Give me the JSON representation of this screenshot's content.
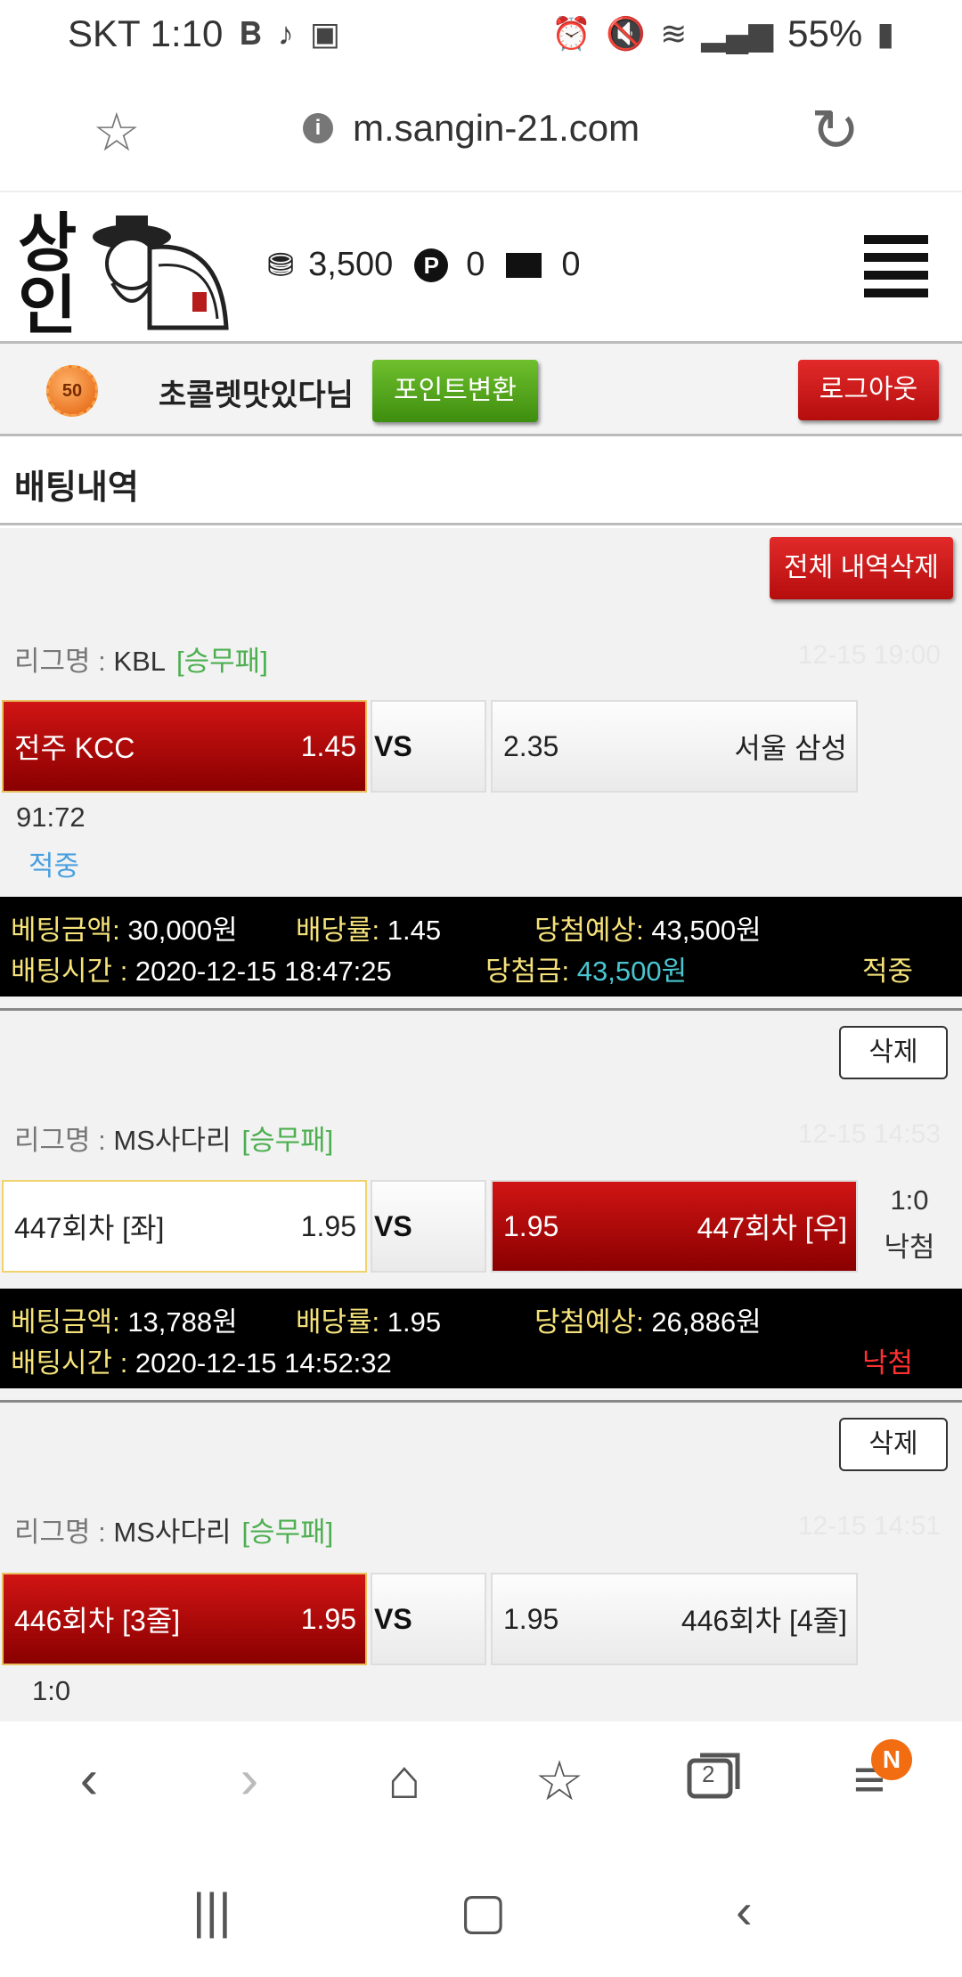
{
  "status": {
    "carrier_time": "SKT 1:10",
    "battery": "55%"
  },
  "browser": {
    "url": "m.sangin-21.com"
  },
  "header": {
    "logo_text": "상인",
    "coins": "3,500",
    "points": "0",
    "messages": "0"
  },
  "userbar": {
    "level": "50",
    "nickname": "초콜렛맛있다님",
    "convert_button": "포인트변환",
    "logout_button": "로그아웃"
  },
  "page": {
    "title": "배팅내역",
    "delete_all_button": "전체 내역삭제"
  },
  "labels": {
    "league_prefix": "리그명 : ",
    "vs": "VS",
    "bet_amount": "베팅금액: ",
    "odds": "배당률: ",
    "expected": "당첨예상: ",
    "bet_time": "배팅시간 : ",
    "win_amount": "당첨금: ",
    "delete": "삭제"
  },
  "bets": [
    {
      "league": "KBL",
      "type": "[승무패]",
      "date": "12-15 19:00",
      "home": "전주 KCC",
      "home_odds": "1.45",
      "away_odds": "2.35",
      "away": "서울 삼성",
      "score": "91:72",
      "game_result": "적중",
      "amount": "30,000원",
      "rate": "1.45",
      "expected": "43,500원",
      "time": "2020-12-15 18:47:25",
      "winnings": "43,500원",
      "status": "적중"
    },
    {
      "league": "MS사다리",
      "type": "[승무패]",
      "date": "12-15 14:53",
      "home": "447회차 [좌]",
      "home_odds": "1.95",
      "away_odds": "1.95",
      "away": "447회차 [우]",
      "score": "1:0",
      "game_result": "낙첨",
      "amount": "13,788원",
      "rate": "1.95",
      "expected": "26,886원",
      "time": "2020-12-15 14:52:32",
      "status": "낙첨"
    },
    {
      "league": "MS사다리",
      "type": "[승무패]",
      "date": "12-15 14:51",
      "home": "446회차 [3줄]",
      "home_odds": "1.95",
      "away_odds": "1.95",
      "away": "446회차 [4줄]",
      "score": "1:0"
    }
  ],
  "nav": {
    "tabs_count": "2",
    "notification_badge": "N"
  },
  "icons": [
    "star-icon",
    "info-icon",
    "reload-icon",
    "coin-icon",
    "point-icon",
    "mail-icon",
    "hamburger-icon",
    "back-icon",
    "forward-icon",
    "home-icon",
    "bookmarks-icon",
    "tabs-icon",
    "menu-icon"
  ]
}
